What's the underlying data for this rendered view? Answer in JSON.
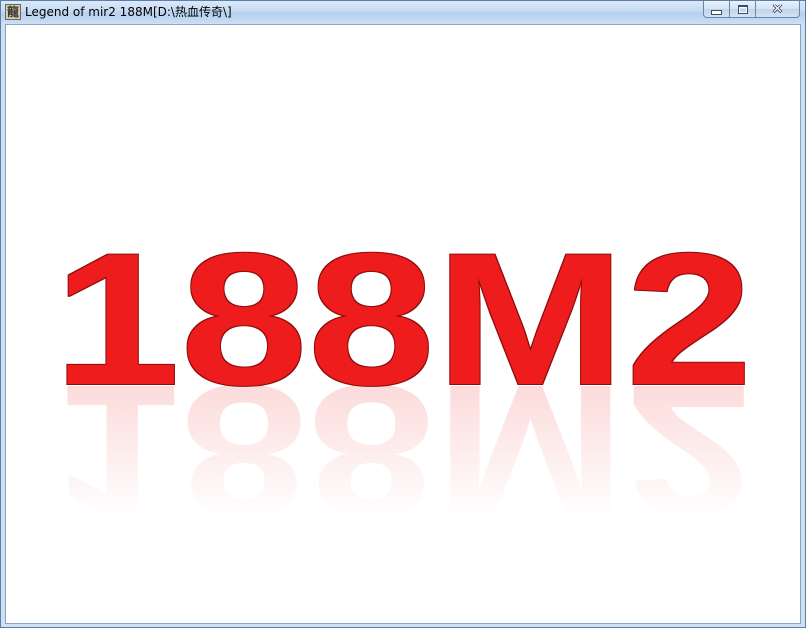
{
  "window": {
    "title": "Legend of mir2 188M[D:\\热血传奇\\]",
    "icon": "legend-app-icon",
    "icon_glyph": "龍",
    "buttons": {
      "minimize_icon": "minimize-icon",
      "maximize_icon": "maximize-icon",
      "close_icon": "close-icon",
      "close_glyph": "✕"
    }
  },
  "splash": {
    "logo_text": "188M2",
    "logo_color": "#ee1c1c",
    "logo_shadow_color": "#8a0a0a",
    "background": "#ffffff"
  }
}
